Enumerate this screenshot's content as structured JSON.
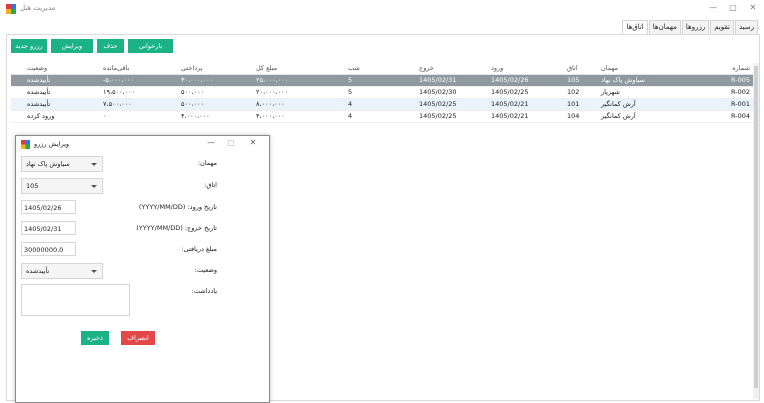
{
  "window": {
    "title": "مدیریت هتل",
    "controls": {
      "minimize": "—",
      "maximize": "▢",
      "close": "✕"
    }
  },
  "tabs": [
    "رسید",
    "تقویم",
    "رزروها",
    "مهمان‌ها",
    "اتاق‌ها"
  ],
  "active_tab": "اتاق‌ها",
  "toolbar": {
    "new": "رزرو جدید",
    "edit": "ویرایش",
    "delete": "حذف",
    "reload": "بارخوانی"
  },
  "table": {
    "headers": {
      "id": "شماره",
      "guest": "مهمان",
      "room": "اتاق",
      "checkin": "ورود",
      "checkout": "خروج",
      "nights": "شب",
      "total": "مبلغ کل",
      "paid": "پرداختی",
      "balance": "باقی‌مانده",
      "status": "وضعیت"
    },
    "rows": [
      {
        "id": "R-005",
        "guest": "سیاوش پاک نهاد",
        "room": "105",
        "checkin": "1405/02/26",
        "checkout": "1405/02/31",
        "nights": "5",
        "total": "۲۵،۰۰۰،۰۰۰",
        "paid": "۳۰،۰۰۰،۰۰۰",
        "balance": "-۵،۰۰۰،۰۰۰",
        "status": "تأییدشده"
      },
      {
        "id": "R-002",
        "guest": "شهریار",
        "room": "102",
        "checkin": "1405/02/25",
        "checkout": "1405/02/30",
        "nights": "5",
        "total": "۲۰،۰۰۰،۰۰۰",
        "paid": "۵۰۰،۰۰۰",
        "balance": "۱۹،۵۰۰،۰۰۰",
        "status": "تأییدشده"
      },
      {
        "id": "R-001",
        "guest": "آرش کمانگیر",
        "room": "101",
        "checkin": "1405/02/21",
        "checkout": "1405/02/25",
        "nights": "4",
        "total": "۸،۰۰۰،۰۰۰",
        "paid": "۵۰۰،۰۰۰",
        "balance": "۷،۵۰۰،۰۰۰",
        "status": "تأییدشده"
      },
      {
        "id": "R-004",
        "guest": "آرش کمانگیر",
        "room": "104",
        "checkin": "1405/02/21",
        "checkout": "1405/02/25",
        "nights": "4",
        "total": "۴،۰۰۰،۰۰۰",
        "paid": "۴،۰۰۰،۰۰۰",
        "balance": "۰",
        "status": "ورود کرده"
      }
    ]
  },
  "dialog": {
    "title": "ویرایش رزرو",
    "controls": {
      "minimize": "—",
      "maximize": "▢",
      "close": "✕"
    },
    "labels": {
      "guest": "مهمان:",
      "room": "اتاق:",
      "checkin": "تاریخ ورود: (YYYY/MM/DD)",
      "checkout": "تاریخ خروج: (YYYY/MM/DD)",
      "paid": "مبلغ دریافتی:",
      "status": "وضعیت:",
      "note": "یادداشت:"
    },
    "values": {
      "guest": "سیاوش پاک نهاد",
      "room": "105",
      "checkin": "1405/02/26",
      "checkout": "1405/02/31",
      "paid": "30000000.0",
      "status": "تأییدشده",
      "note": ""
    },
    "buttons": {
      "save": "ذخیره",
      "cancel": "انصراف"
    }
  },
  "colors": {
    "accent_green": "#1bb386",
    "danger_red": "#e34848",
    "selected_row": "#8e9a9f"
  }
}
